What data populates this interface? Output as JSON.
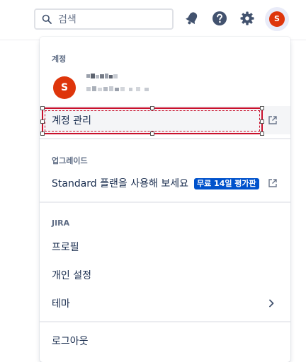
{
  "search": {
    "placeholder": "검색",
    "value": ""
  },
  "topbar": {
    "notifications_icon": "bell-icon",
    "help_icon": "help-icon",
    "settings_icon": "gear-icon",
    "avatar_initial": "S"
  },
  "menu": {
    "account": {
      "title": "계정",
      "avatar_initial": "S",
      "manage_label": "계정 관리"
    },
    "upgrade": {
      "title": "업그레이드",
      "plan_label": "Standard 플랜을 사용해 보세요",
      "trial_badge": "무료 14일 평가판"
    },
    "jira": {
      "title": "JIRA",
      "profile_label": "프로필",
      "personal_settings_label": "개인 설정",
      "theme_label": "테마"
    },
    "logout_label": "로그아웃"
  },
  "colors": {
    "avatar": "#de350b",
    "badge": "#0052cc",
    "selection": "#c9102c",
    "text": "#172b4d",
    "section_title": "#5e6c84"
  }
}
